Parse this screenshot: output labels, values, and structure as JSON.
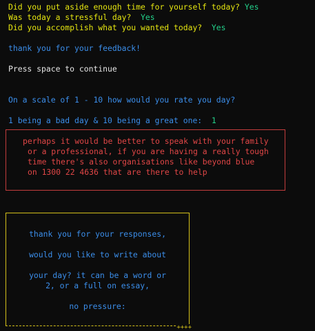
{
  "survey": {
    "q_time": "Did you put aside enough time for yourself today?",
    "a_time": "Yes",
    "q_stress": "Was today a stressful day?",
    "a_stress": "Yes",
    "q_accomplish": "Did you accomplish what you wanted today?",
    "a_accomplish": "Yes"
  },
  "feedback_thanks": "thank you for your feedback!",
  "continue_prompt": "Press space to continue",
  "rating": {
    "question": "On a scale of 1 - 10 how would you rate you day?",
    "scale_hint": "1 being a bad day & 10 being a great one:",
    "answer": "1"
  },
  "advice_box": {
    "lines": [
      "perhaps it would be better to speak with your family",
      "or a professional, if you are having a really tough",
      "time there's also organisations like beyond blue",
      "on 1300 22 4636 that are there to help"
    ]
  },
  "journal_box": {
    "lines": [
      "thank you for your responses,",
      "would you like to write about",
      "your day? it can be a word or",
      "2, or a full on essay,",
      "no pressure:"
    ],
    "corner": "++++"
  },
  "colors": {
    "background": "#0c0c0c",
    "question_yellow": "#e5e510",
    "answer_green": "#23d18b",
    "info_blue": "#3b8eea",
    "warning_red": "#e04646"
  }
}
